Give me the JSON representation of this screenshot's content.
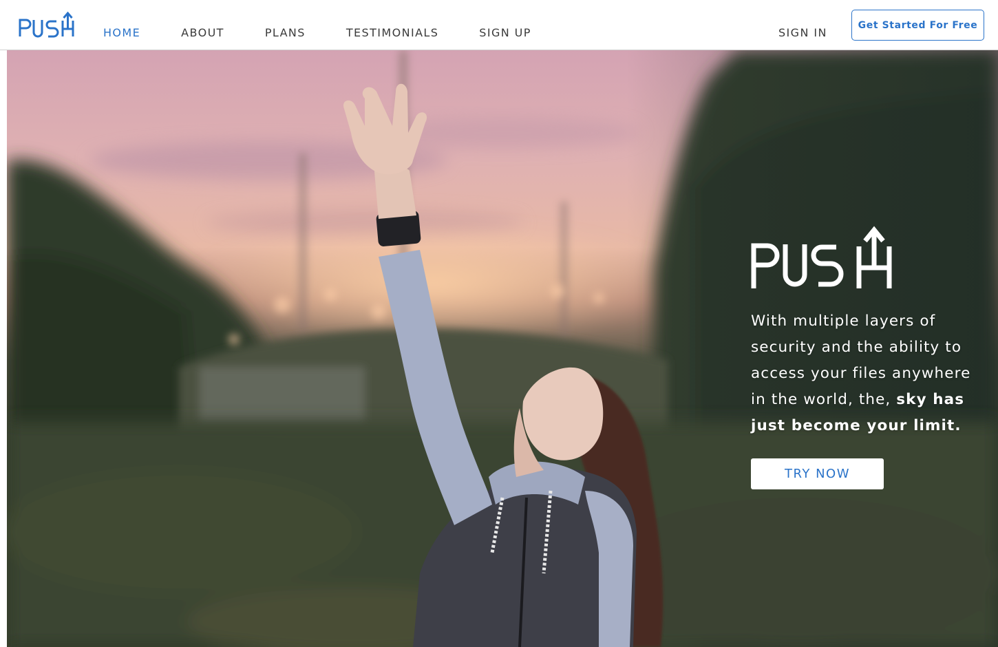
{
  "brand": {
    "name": "PUSH",
    "accent_color": "#2a73c9"
  },
  "nav": {
    "items": [
      {
        "label": "HOME",
        "active": true
      },
      {
        "label": "ABOUT",
        "active": false
      },
      {
        "label": "PLANS",
        "active": false
      },
      {
        "label": "TESTIMONIALS",
        "active": false
      },
      {
        "label": "SIGN UP",
        "active": false
      }
    ],
    "signin_label": "SIGN IN",
    "cta_label": "Get Started For Free"
  },
  "hero": {
    "logo_text": "PUSH",
    "text_part1": "With multiple layers of security and the ability to access your files anywhere in the world, the, ",
    "text_bold": "sky has just become your limit.",
    "button_label": "TRY NOW",
    "image_description_icon": "woman-reaching-sky-photo"
  }
}
